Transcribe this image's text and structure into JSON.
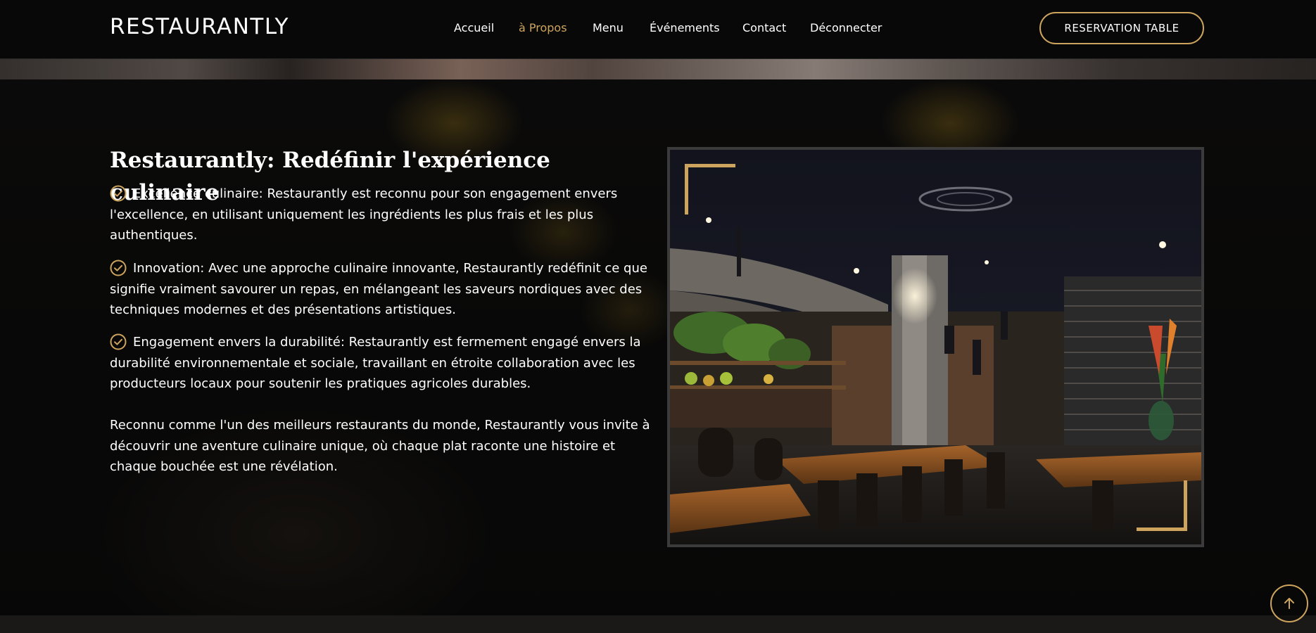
{
  "brand": {
    "logo_text": "RESTAURANTLY"
  },
  "nav": {
    "items": [
      {
        "label": "Accueil",
        "active": false
      },
      {
        "label": "à Propos",
        "active": true
      },
      {
        "label": "Menu",
        "active": false
      },
      {
        "label": "Événements",
        "active": false
      },
      {
        "label": "Contact",
        "active": false
      },
      {
        "label": "Déconnecter",
        "active": false
      }
    ],
    "cta_label": "RESERVATION TABLE"
  },
  "about": {
    "title": "Restaurantly: Redéfinir l'expérience culinaire",
    "features": [
      "Excellence culinaire: Restaurantly est reconnu pour son engagement envers l'excellence, en utilisant uniquement les ingrédients les plus frais et les plus authentiques.",
      "Innovation: Avec une approche culinaire innovante, Restaurantly redéfinit ce que signifie vraiment savourer un repas, en mélangeant les saveurs nordiques avec des techniques modernes et des présentations artistiques.",
      "Engagement envers la durabilité: Restaurantly est fermement engagé envers la durabilité environnementale et sociale, travaillant en étroite collaboration avec les producteurs locaux pour soutenir les pratiques agricoles durables."
    ],
    "paragraph": "Reconnu comme l'un des meilleurs restaurants du monde, Restaurantly vous invite à découvrir une aventure culinaire unique, où chaque plat raconte une histoire et chaque bouchée est une révélation."
  },
  "icons": {
    "feature_icon": "check-circle-icon",
    "back_to_top_icon": "arrow-up-icon"
  },
  "colors": {
    "accent": "#cda45e",
    "background": "#0b0b0c",
    "text": "#ffffff"
  }
}
